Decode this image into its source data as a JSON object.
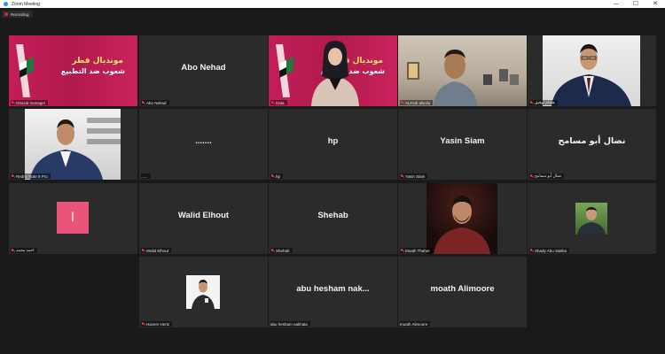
{
  "window": {
    "title": "Zoom Meeting",
    "minimize": "—",
    "maximize": "☐",
    "close": "✕"
  },
  "recording": {
    "label": "Recording"
  },
  "banner": {
    "line1": "مونديال قطر",
    "line2": "شعوب ضد التطبيع"
  },
  "tiles": [
    {
      "name": "Ghazal manager",
      "center": "",
      "kind": "banner"
    },
    {
      "name": "Abo Nehad",
      "center": "Abo Nehad",
      "kind": "text"
    },
    {
      "name": "Data",
      "center": "",
      "kind": "banner-person"
    },
    {
      "name": "ALFaib alsolia",
      "center": "",
      "kind": "video-room",
      "active": true
    },
    {
      "name": "هشام توفيق",
      "center": "",
      "kind": "video-suit"
    },
    {
      "name": "Redmi Note 8 Pro",
      "center": "",
      "kind": "video-man"
    },
    {
      "name": "......",
      "center": ".......",
      "kind": "text"
    },
    {
      "name": "hp",
      "center": "hp",
      "kind": "text"
    },
    {
      "name": "Yasin Siam",
      "center": "Yasin Siam",
      "kind": "text"
    },
    {
      "name": "نضال أبو مسامح",
      "center": "نضال أبو مسامح",
      "kind": "text"
    },
    {
      "name": "احمد محمد",
      "center": "",
      "kind": "avatar",
      "letter": "ا"
    },
    {
      "name": "Walid Elhout",
      "center": "Walid Elhout",
      "kind": "text"
    },
    {
      "name": "Shehab",
      "center": "Shehab",
      "kind": "text"
    },
    {
      "name": "Moath Thaher",
      "center": "",
      "kind": "photo-dark"
    },
    {
      "name": "Shady Abu Sabha",
      "center": "",
      "kind": "photo-small"
    },
    {
      "name": "Hazem Hertz",
      "center": "",
      "kind": "photo-tiny"
    },
    {
      "name": "abu hesham nakhala",
      "center": "abu hesham nak...",
      "kind": "text"
    },
    {
      "name": "moath Alimoore",
      "center": "moath Alimoore",
      "kind": "text"
    }
  ],
  "colors": {
    "tile_bg": "#2b2b2b",
    "stage_bg": "#1a1a1a",
    "active_border": "#d7e14a",
    "recording_dot": "#e02828",
    "banner": "#c31d5a",
    "avatar": "#e8547a"
  }
}
